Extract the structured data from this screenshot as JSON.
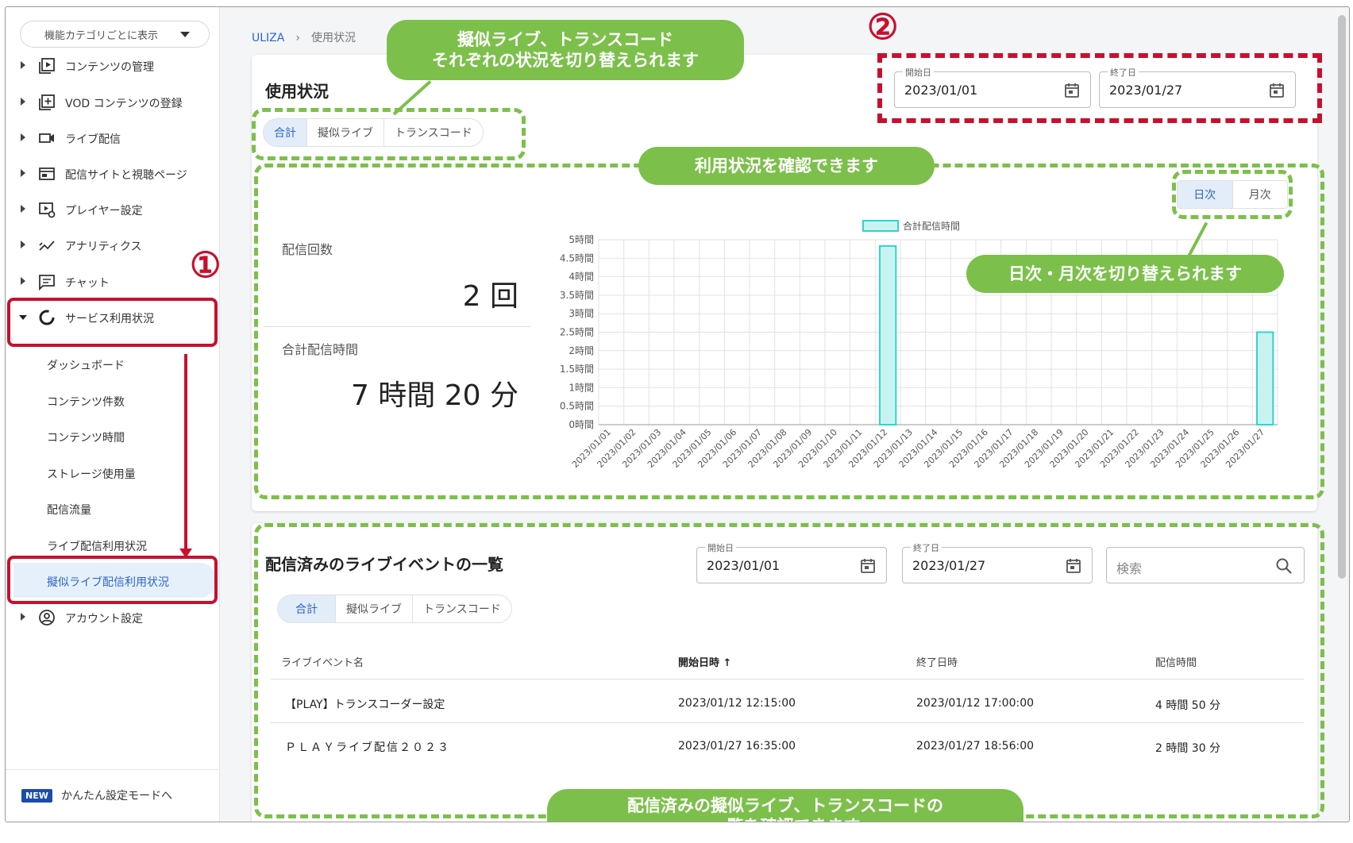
{
  "sidebar": {
    "category_select": "機能カテゴリごとに表示",
    "items": [
      {
        "label": "コンテンツの管理",
        "icon": "video-library-icon"
      },
      {
        "label": "VOD コンテンツの登録",
        "icon": "add-box-icon"
      },
      {
        "label": "ライブ配信",
        "icon": "videocam-icon"
      },
      {
        "label": "配信サイトと視聴ページ",
        "icon": "web-page-icon"
      },
      {
        "label": "プレイヤー設定",
        "icon": "player-settings-icon"
      },
      {
        "label": "アナリティクス",
        "icon": "analytics-icon"
      },
      {
        "label": "チャット",
        "icon": "chat-icon"
      },
      {
        "label": "サービス利用状況",
        "icon": "donut-chart-icon"
      }
    ],
    "sub_items": [
      "ダッシュボード",
      "コンテンツ件数",
      "コンテンツ時間",
      "ストレージ使用量",
      "配信流量",
      "ライブ配信利用状況",
      "擬似ライブ配信利用状況"
    ],
    "account": "アカウント設定",
    "new_badge": "NEW",
    "simple_mode": "かんたん設定モードへ"
  },
  "breadcrumb": {
    "home": "ULIZA",
    "separator": "›",
    "current": "使用状況"
  },
  "usage": {
    "title": "使用状況",
    "tabs": [
      "合計",
      "擬似ライブ",
      "トランスコード"
    ],
    "start_label": "開始日",
    "start_value": "2023/01/01",
    "end_label": "終了日",
    "end_value": "2023/01/27",
    "count_label": "配信回数",
    "count_value": "2 回",
    "time_label": "合計配信時間",
    "time_value": "7 時間 20 分",
    "period_tabs": [
      "日次",
      "月次"
    ]
  },
  "chart_data": {
    "type": "bar",
    "title": "",
    "xlabel": "",
    "ylabel": "",
    "legend": "合計配信時間",
    "legend_position": "top-center",
    "ylim": [
      0,
      5
    ],
    "y_ticks": [
      "0時間",
      "0.5時間",
      "1時間",
      "1.5時間",
      "2時間",
      "2.5時間",
      "3時間",
      "3.5時間",
      "4時間",
      "4.5時間",
      "5時間"
    ],
    "categories": [
      "2023/01/01",
      "2023/01/02",
      "2023/01/03",
      "2023/01/04",
      "2023/01/05",
      "2023/01/06",
      "2023/01/07",
      "2023/01/08",
      "2023/01/09",
      "2023/01/10",
      "2023/01/11",
      "2023/01/12",
      "2023/01/13",
      "2023/01/14",
      "2023/01/15",
      "2023/01/16",
      "2023/01/17",
      "2023/01/18",
      "2023/01/19",
      "2023/01/20",
      "2023/01/21",
      "2023/01/22",
      "2023/01/23",
      "2023/01/24",
      "2023/01/25",
      "2023/01/26",
      "2023/01/27"
    ],
    "series": [
      {
        "name": "合計配信時間",
        "values": [
          0,
          0,
          0,
          0,
          0,
          0,
          0,
          0,
          0,
          0,
          0,
          4.83,
          0,
          0,
          0,
          0,
          0,
          0,
          0,
          0,
          0,
          0,
          0,
          0,
          0,
          0,
          2.5
        ]
      }
    ],
    "grid": true,
    "colors": {
      "fill": "#c9f3f1",
      "stroke": "#2fd5cc"
    }
  },
  "events": {
    "title": "配信済みのライブイベントの一覧",
    "start_label": "開始日",
    "start_value": "2023/01/01",
    "end_label": "終了日",
    "end_value": "2023/01/27",
    "search_placeholder": "検索",
    "tabs": [
      "合計",
      "擬似ライブ",
      "トランスコード"
    ],
    "columns": [
      "ライブイベント名",
      "開始日時",
      "終了日時",
      "配信時間"
    ],
    "sort_indicator": "↑",
    "rows": [
      [
        "【PLAY】トランスコーダー設定",
        "2023/01/12 12:15:00",
        "2023/01/12 17:00:00",
        "4 時間 50 分"
      ],
      [
        "ＰＬＡＹライブ配信２０２３",
        "2023/01/27 16:35:00",
        "2023/01/27 18:56:00",
        "2 時間 30 分"
      ]
    ]
  },
  "annotations": {
    "num1": "①",
    "num2": "②",
    "callout_tabs": [
      "擬似ライブ、トランスコード",
      "それぞれの状況を切り替えられます"
    ],
    "callout_usage": "利用状況を確認できます",
    "callout_period": "日次・月次を切り替えられます",
    "callout_list": [
      "配信済みの擬似ライブ、トランスコードの",
      "一覧を確認できます"
    ]
  },
  "colors": {
    "accent": "#2c66c6",
    "annotation_red": "#c8102e",
    "annotation_green": "#7cc04b"
  }
}
